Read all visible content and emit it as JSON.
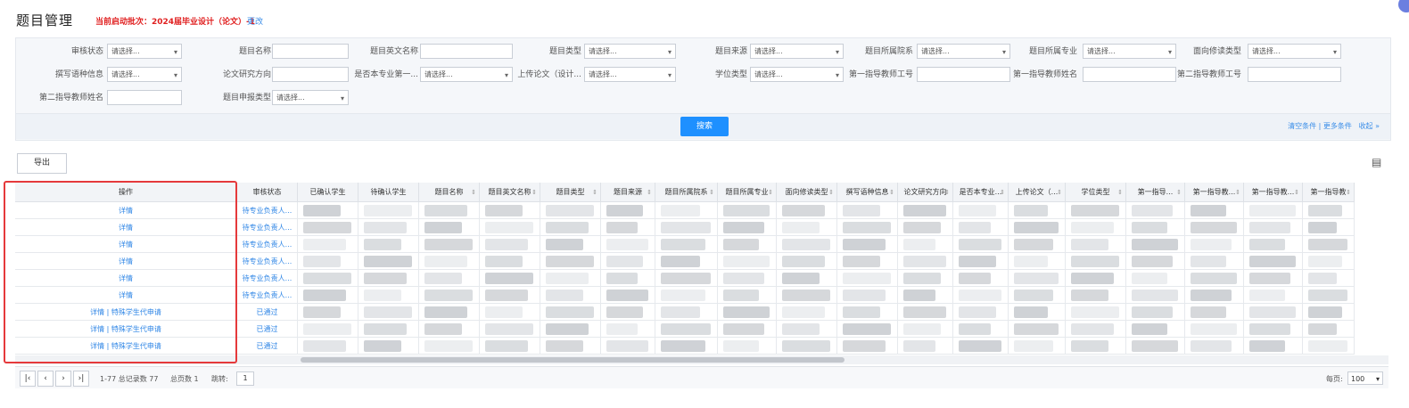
{
  "header": {
    "title": "题目管理",
    "batch": "当前启动批次：2024届毕业设计（论文）-1",
    "change_label": "更改"
  },
  "filters": {
    "rows": [
      [
        {
          "label": "审核状态",
          "type": "select",
          "placeholder": "请选择..."
        },
        {
          "label": "题目名称",
          "type": "input",
          "value": ""
        },
        {
          "label": "题目英文名称",
          "type": "input",
          "value": ""
        },
        {
          "label": "题目类型",
          "type": "select",
          "placeholder": "请选择..."
        },
        {
          "label": "题目来源",
          "type": "select",
          "placeholder": "请选择..."
        },
        {
          "label": "题目所属院系",
          "type": "select",
          "placeholder": "请选择..."
        },
        {
          "label": "题目所属专业",
          "type": "select",
          "placeholder": "请选择..."
        },
        {
          "label": "面向修读类型",
          "type": "select",
          "placeholder": "请选择..."
        }
      ],
      [
        {
          "label": "撰写语种信息",
          "type": "select",
          "placeholder": "请选择..."
        },
        {
          "label": "论文研究方向",
          "type": "input",
          "value": ""
        },
        {
          "label": "是否本专业第一...",
          "type": "select",
          "placeholder": "请选择..."
        },
        {
          "label": "上传论文（设计...",
          "type": "select",
          "placeholder": "请选择..."
        },
        {
          "label": "学位类型",
          "type": "select",
          "placeholder": "请选择..."
        },
        {
          "label": "第一指导教师工号",
          "type": "input",
          "value": ""
        },
        {
          "label": "第一指导教师姓名",
          "type": "input",
          "value": ""
        },
        {
          "label": "第二指导教师工号",
          "type": "input",
          "value": ""
        }
      ],
      [
        {
          "label": "第二指导教师姓名",
          "type": "input",
          "value": ""
        },
        {
          "label": "题目申报类型",
          "type": "select",
          "placeholder": "请选择..."
        }
      ]
    ],
    "search_label": "搜索",
    "clear_label": "清空条件",
    "more_label": "更多条件",
    "collapse_label": "收起 »"
  },
  "toolbar": {
    "export_label": "导出"
  },
  "table": {
    "columns": [
      "操作",
      "审核状态",
      "已确认学生",
      "待确认学生",
      "题目名称",
      "题目英文名称",
      "题目类型",
      "题目来源",
      "题目所属院系",
      "题目所属专业",
      "面向修读类型",
      "撰写语种信息",
      "论文研究方向",
      "是否本专业...",
      "上传论文（...",
      "学位类型",
      "第一指导...",
      "第一指导教...",
      "第一指导教...",
      "第一指导教"
    ],
    "rows": [
      {
        "action": "详情",
        "action2": "",
        "status": "待专业负责人..."
      },
      {
        "action": "详情",
        "action2": "",
        "status": "待专业负责人..."
      },
      {
        "action": "详情",
        "action2": "",
        "status": "待专业负责人..."
      },
      {
        "action": "详情",
        "action2": "",
        "status": "待专业负责人..."
      },
      {
        "action": "详情",
        "action2": "",
        "status": "待专业负责人..."
      },
      {
        "action": "详情",
        "action2": "",
        "status": "待专业负责人..."
      },
      {
        "action": "详情",
        "action2": "特殊学生代申请",
        "status": "已通过"
      },
      {
        "action": "详情",
        "action2": "特殊学生代申请",
        "status": "已通过"
      },
      {
        "action": "详情",
        "action2": "特殊学生代申请",
        "status": "已通过"
      }
    ]
  },
  "pager": {
    "range_text": "1-77 总记录数 77",
    "pages_text": "总页数 1",
    "jump_label": "跳转:",
    "current_page": "1",
    "per_page_label": "每页:",
    "per_page_value": "100"
  }
}
